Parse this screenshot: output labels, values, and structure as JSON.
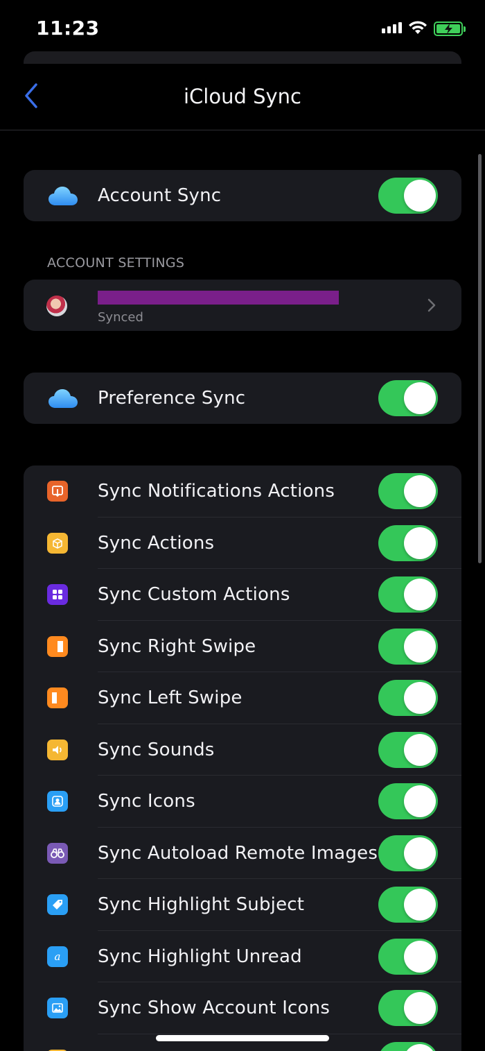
{
  "status_bar": {
    "time": "11:23",
    "battery_color": "#3fcf5a"
  },
  "nav": {
    "title": "iCloud Sync",
    "back_icon": "chevron-left-icon"
  },
  "account_sync": {
    "label": "Account Sync",
    "on": true,
    "icon": "cloud-icon"
  },
  "account_settings": {
    "header": "ACCOUNT SETTINGS",
    "account": {
      "status": "Synced",
      "avatar": "avatar",
      "email_redacted": true
    }
  },
  "preference_sync": {
    "label": "Preference Sync",
    "on": true,
    "icon": "cloud-icon"
  },
  "sync_items": [
    {
      "label": "Sync Notifications Actions",
      "icon": "notification-action-icon",
      "color": "#e8642a",
      "on": true
    },
    {
      "label": "Sync Actions",
      "icon": "box-icon",
      "color": "#f5b733",
      "on": true
    },
    {
      "label": "Sync Custom Actions",
      "icon": "grid-icon",
      "color": "#6a2be0",
      "on": true
    },
    {
      "label": "Sync Right Swipe",
      "icon": "right-swipe-icon",
      "color": "#ff8a1f",
      "on": true
    },
    {
      "label": "Sync Left Swipe",
      "icon": "left-swipe-icon",
      "color": "#ff8a1f",
      "on": true
    },
    {
      "label": "Sync Sounds",
      "icon": "speaker-icon",
      "color": "#f5b733",
      "on": true
    },
    {
      "label": "Sync Icons",
      "icon": "contact-icon",
      "color": "#2a9ff5",
      "on": true
    },
    {
      "label": "Sync Autoload Remote Images",
      "icon": "binoculars-icon",
      "color": "#7a5ab5",
      "on": true
    },
    {
      "label": "Sync Highlight Subject",
      "icon": "tag-icon",
      "color": "#2a9ff5",
      "on": true
    },
    {
      "label": "Sync Highlight Unread",
      "icon": "letter-a-icon",
      "color": "#2a9ff5",
      "on": true
    },
    {
      "label": "Sync Show Account Icons",
      "icon": "image-icon",
      "color": "#2a9ff5",
      "on": true
    },
    {
      "label": "",
      "icon": "partial-icon",
      "color": "#f5b733",
      "on": true
    }
  ],
  "colors": {
    "toggle_on": "#34c759",
    "card_bg": "#1a1b20",
    "accent": "#3a6ee8"
  }
}
